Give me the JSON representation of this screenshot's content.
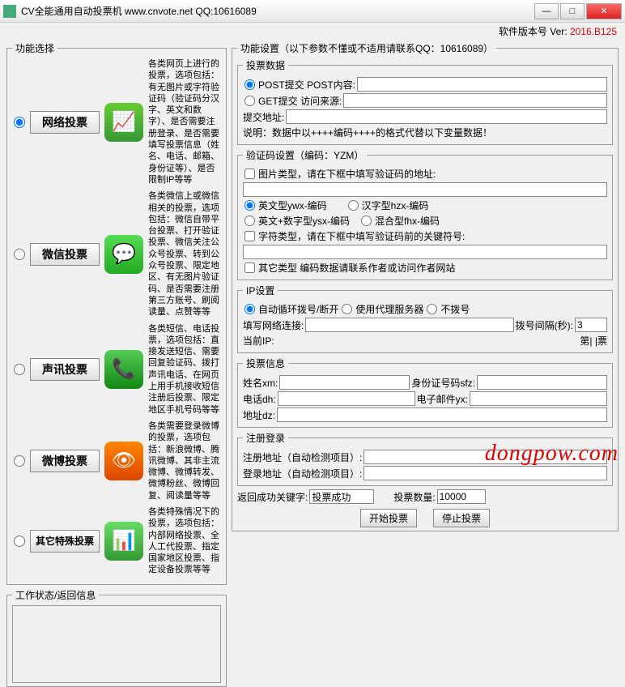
{
  "window": {
    "title": "CV全能通用自动投票机   www.cnvote.net   QQ:10616089"
  },
  "version": {
    "label": "软件版本号 Ver:",
    "value": "2016.B125"
  },
  "func_select": {
    "legend": "功能选择",
    "options": [
      {
        "label": "网络投票",
        "desc": "各类网页上进行的投票，选项包括：有无图片或字符验证码（验证码分汉字、英文和数字）、是否需要注册登录、是否需要填写投票信息（姓名、电话、邮箱、身份证等）、是否限制IP等等"
      },
      {
        "label": "微信投票",
        "desc": "各类微信上或微信相关的投票，选项包括：微信自带平台投票、打开验证投票、微信关注公众号投票、转到公众号投票、限定地区、有无图片验证码、是否需要注册第三方账号、刷阅读量、点赞等等"
      },
      {
        "label": "声讯投票",
        "desc": "各类短信、电话投票，选项包括：直接发送短信、需要回复验证码、拨打声讯电话、在网页上用手机接收短信注册后投票、限定地区手机号码等等"
      },
      {
        "label": "微博投票",
        "desc": "各类需要登录微博的投票，选项包括：新浪微博、腾讯微博、其非主流微博、微博转发、微博粉丝、微博回复、阅读量等等"
      },
      {
        "label": "其它特殊投票",
        "desc": "各类特殊情况下的投票，选项包括：内部网络投票、全人工代投票、指定国家地区投票、指定设备投票等等"
      }
    ]
  },
  "status": {
    "legend": "工作状态/返回信息"
  },
  "settings": {
    "legend": "功能设置（以下参数不懂或不适用请联系QQ：10616089）",
    "data": {
      "legend": "投票数据",
      "post_label": "POST提交  POST内容:",
      "get_label": "GET提交   访问来源:",
      "submit_url": "提交地址:",
      "note": "说明：数据中以++++编码++++的格式代替以下变量数据！"
    },
    "captcha": {
      "legend": "验证码设置（编码：YZM）",
      "img_label": "图片类型，请在下框中填写验证码的地址:",
      "types": [
        "英文型ywx-编码",
        "汉字型hzx-编码",
        "英文+数字型ysx-编码",
        "混合型fhx-编码"
      ],
      "char_label": "字符类型，请在下框中填写验证码前的关键符号:",
      "other_label": "其它类型     编码数据请联系作者或访问作者网站"
    },
    "ip": {
      "legend": "IP设置",
      "opts": [
        "自动循环拨号/断开",
        "使用代理服务器",
        "不拨号"
      ],
      "conn_label": "填写网络连接:",
      "interval_label": "拨号间隔(秒):",
      "interval_value": "3",
      "current_ip": "当前IP:",
      "counter_label": "第|      |票"
    },
    "voteinfo": {
      "legend": "投票信息",
      "name": "姓名xm:",
      "id": "身份证号码sfz:",
      "phone": "电话dh:",
      "email": "电子邮件yx:",
      "addr": "地址dz:"
    },
    "reg": {
      "legend": "注册登录",
      "reg_label": "注册地址（自动检测项目）:",
      "login_label": "登录地址（自动检测项目）:"
    },
    "success_label": "返回成功关键字:",
    "success_value": "投票成功",
    "count_label": "投票数量:",
    "count_value": "10000",
    "start": "开始投票",
    "stop": "停止投票"
  },
  "watermark": "dongpow.com"
}
